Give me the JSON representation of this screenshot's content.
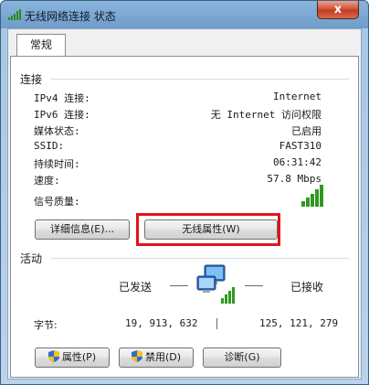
{
  "window": {
    "title": "无线网络连接 状态",
    "close_label": "x",
    "icon": "wireless-signal-icon"
  },
  "tabs": [
    "常规"
  ],
  "connection": {
    "section_label": "连接",
    "rows": [
      {
        "label": "IPv4 连接:",
        "value": "Internet"
      },
      {
        "label": "IPv6 连接:",
        "value": "无 Internet 访问权限"
      },
      {
        "label": "媒体状态:",
        "value": "已启用"
      },
      {
        "label": "SSID:",
        "value": "FAST310"
      },
      {
        "label": "持续时间:",
        "value": "06:31:42"
      },
      {
        "label": "速度:",
        "value": "57.8 Mbps"
      }
    ],
    "signal_label": "信号质量:",
    "signal_bars": 5,
    "details_button": "详细信息(E)...",
    "wireless_props_button": "无线属性(W)"
  },
  "activity": {
    "section_label": "活动",
    "sent_label": "已发送",
    "received_label": "已接收",
    "bytes_label": "字节:",
    "bytes_sent": "19, 913, 632",
    "bytes_received": "125, 121, 279"
  },
  "bottom_buttons": {
    "properties": "属性(P)",
    "disable": "禁用(D)",
    "diagnose": "诊断(G)"
  },
  "colors": {
    "highlight_border": "#e0141b",
    "signal_green": "#2f9a1f"
  }
}
